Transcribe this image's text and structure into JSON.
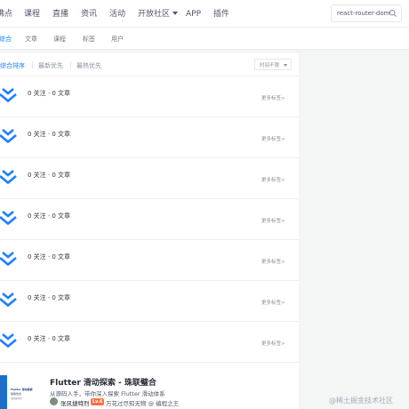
{
  "nav": {
    "items": [
      {
        "label": "沸点"
      },
      {
        "label": "课程"
      },
      {
        "label": "直播"
      },
      {
        "label": "资讯"
      },
      {
        "label": "活动"
      },
      {
        "label": "开放社区"
      },
      {
        "label": "APP"
      },
      {
        "label": "插件"
      }
    ],
    "search_value": "react-router-dom"
  },
  "subnav": {
    "items": [
      {
        "label": "综合"
      },
      {
        "label": "文章"
      },
      {
        "label": "课程"
      },
      {
        "label": "标签"
      },
      {
        "label": "用户"
      }
    ],
    "active_index": 0
  },
  "sortbar": {
    "items": [
      {
        "label": "综合排序"
      },
      {
        "label": "最新优先"
      },
      {
        "label": "最热优先"
      }
    ],
    "period": "时间不限"
  },
  "tags": [
    {
      "stats": "0 关注 · 0 文章",
      "more": "更多标签>"
    },
    {
      "stats": "0 关注 · 0 文章",
      "more": "更多标签>"
    },
    {
      "stats": "0 关注 · 0 文章",
      "more": "更多标签>"
    },
    {
      "stats": "0 关注 · 0 文章",
      "more": "更多标签>"
    },
    {
      "stats": "0 关注 · 0 文章",
      "more": "更多标签>"
    },
    {
      "stats": "0 关注 · 0 文章",
      "more": "更多标签>"
    },
    {
      "stats": "0 关注 · 0 文章",
      "more": "更多标签>"
    }
  ],
  "article": {
    "title": "Flutter 滑动探索 - 珠联璧合",
    "description": "从源码入手，带你深入探索 Flutter 滑动体系",
    "author": "张风捷特烈",
    "level": "Lv.6",
    "bio": "万花过尽知无物 @ 编程之王",
    "cover_line1": "Flutter 滑动探索",
    "cover_line2": "珠联璧合",
    "cover_line3": "张风捷特烈"
  },
  "watermark": "@稀土掘金技术社区",
  "colors": {
    "accent": "#1e80ff",
    "logo": "#1e80ff"
  }
}
